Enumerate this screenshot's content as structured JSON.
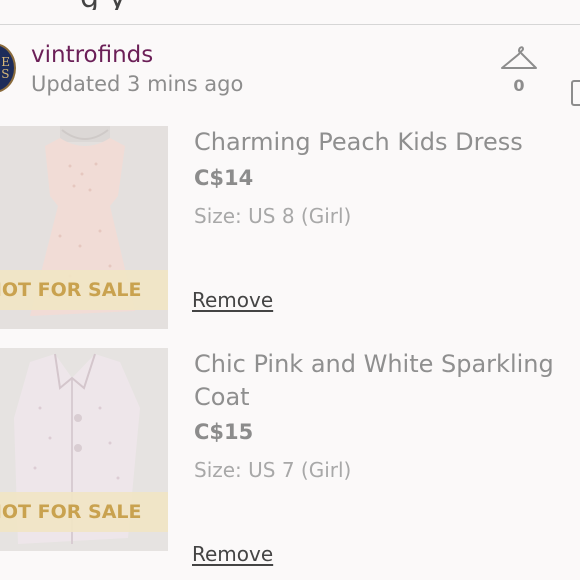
{
  "page": {
    "title_partial": "g y"
  },
  "seller": {
    "username": "vintrofinds",
    "updated": "Updated 3 mins ago",
    "avatar_text": "E\nS"
  },
  "likes": {
    "icon": "hanger-icon",
    "count": "0"
  },
  "items": [
    {
      "title": "Charming Peach Kids Dress",
      "price": "C$14",
      "size": "Size: US 8 (Girl)",
      "banner": "NOT FOR SALE",
      "remove_label": "Remove"
    },
    {
      "title": "Chic Pink and White Sparkling Coat",
      "price": "C$15",
      "size": "Size: US 7 (Girl)",
      "banner": "NOT FOR SALE",
      "remove_label": "Remove"
    }
  ],
  "colors": {
    "username": "#6b1f57",
    "banner_text": "#c9a24f",
    "banner_bg": "#f1e5c4"
  }
}
